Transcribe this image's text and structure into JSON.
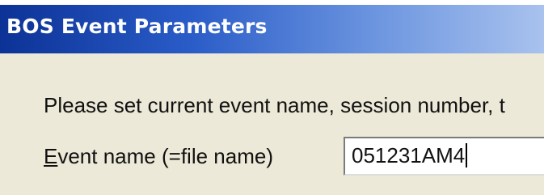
{
  "window": {
    "title": "BOS Event Parameters"
  },
  "dialog": {
    "instruction": "Please set current event name, session number, t",
    "event_name_label_mnemonic": "E",
    "event_name_label_rest": "vent name (=file name)",
    "event_name_value": "051231AM4"
  },
  "colors": {
    "titlebar_start": "#0c3296",
    "titlebar_end": "#a9c2ee",
    "dialog_background": "#ece9d8"
  }
}
